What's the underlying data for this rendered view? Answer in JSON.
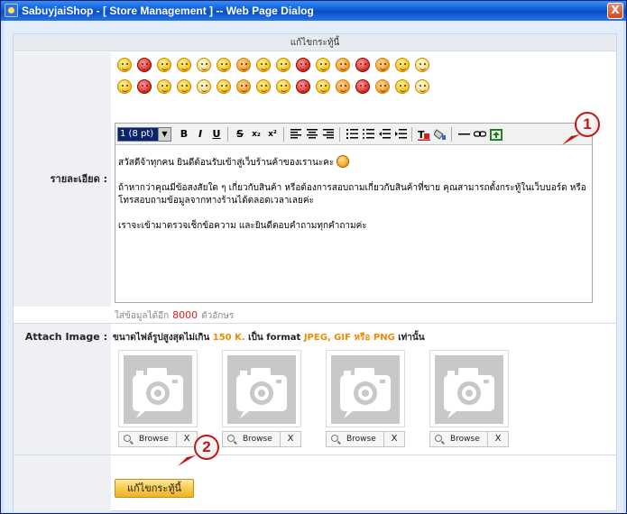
{
  "window": {
    "title": "SabuyjaiShop - [ Store Management ] -- Web Page Dialog",
    "close_symbol": "X"
  },
  "form": {
    "header": "แก้ไขกระทู้นี้",
    "detail_label": "รายละเอียด :",
    "attach_label": "Attach Image :"
  },
  "emoticons": {
    "row1": [
      "laugh-icon",
      "angry-blush-icon",
      "cool-icon",
      "grin-icon",
      "sleepy-icon",
      "nerd-icon",
      "blush-icon",
      "shocked-icon",
      "kiss-icon",
      "mad-icon",
      "sweat-icon",
      "tongue-icon",
      "red-angry-icon",
      "wink-icon",
      "wave-icon",
      "confused-icon"
    ],
    "row2": [
      "squint-icon",
      "smile-icon",
      "smug-icon",
      "fire-angry-icon",
      "surprised-icon",
      "dizzy-icon",
      "writing-icon",
      "yawn-icon",
      "heart-eyes-icon",
      "dead-icon",
      "hat-icon",
      "big-eyes-icon",
      "sad-icon",
      "clown-icon",
      "star-icon",
      "sunglasses-icon"
    ]
  },
  "toolbar": {
    "font_size": "1 (8 pt)",
    "bold": "B",
    "italic": "I",
    "underline": "U",
    "strike": "S",
    "subscript": "x₂",
    "superscript": "x²"
  },
  "editor": {
    "line1": "สวัสดีจ้าทุกคน ยินดีต้อนรับเข้าสู่เว็บร้านค้าของเรานะคะ",
    "line2": "ถ้าหากว่าคุณมีข้อสงสัยใด ๆ เกี่ยวกับสินค้า หรือต้องการสอบถามเกี่ยวกับสินค้าที่ขาย คุณสามารถตั้งกระทู้ในเว็บบอร์ด หรือโทรสอบถามข้อมูลจากทางร้านได้ตลอดเวลาเลยค่ะ",
    "line3": "เราจะเข้ามาตรวจเช็กข้อความ และยินดีตอบคำถามทุกคำถามค่ะ"
  },
  "char_count": {
    "prefix": "ใส่ข้อมูลได้อีก",
    "value": "8000",
    "suffix": "ตัวอักษร"
  },
  "attach": {
    "note_prefix": "ขนาดไฟล์รูปสูงสุดไม่เกิน",
    "size": "150 K.",
    "note_mid": "เป็น format",
    "formats": "JPEG, GIF หรือ PNG",
    "note_suffix": "เท่านั้น",
    "slots": [
      {
        "browse": "Browse",
        "remove": "X"
      },
      {
        "browse": "Browse",
        "remove": "X"
      },
      {
        "browse": "Browse",
        "remove": "X"
      },
      {
        "browse": "Browse",
        "remove": "X"
      }
    ]
  },
  "submit": {
    "label": "แก้ไขกระทู้นี้"
  },
  "callouts": {
    "one": "1",
    "two": "2"
  },
  "colors": {
    "accent_red": "#e21c1c",
    "highlight_orange": "#f08a00",
    "callout_red": "#c21616",
    "button_gold": "#f7c84a"
  }
}
